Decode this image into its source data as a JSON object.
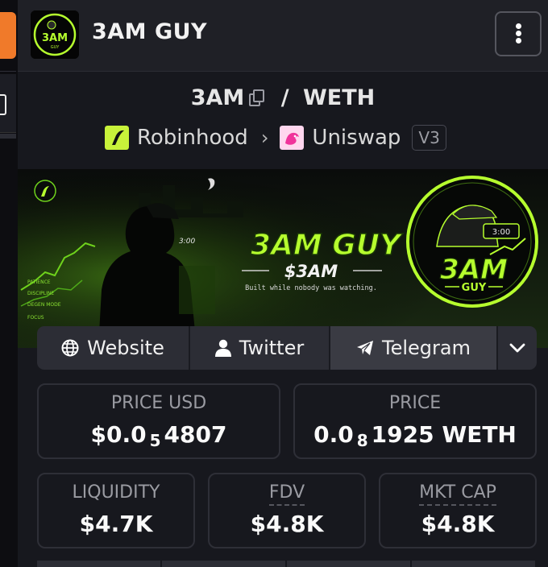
{
  "header": {
    "title": "3AM GUY"
  },
  "pair": {
    "base": "3AM",
    "separator": "/",
    "quote": "WETH"
  },
  "chain": {
    "name": "Robinhood",
    "dex": "Uniswap",
    "version": "V3"
  },
  "banner": {
    "title": "3AM GUY",
    "ticker": "$3AM",
    "tagline": "Built while nobody was watching.",
    "time": "3:00",
    "badge_title": "3AM",
    "badge_sub": "GUY",
    "side_labels": [
      "PATIENCE",
      "DISCIPLINE",
      "DEGEN MODE",
      "FOCUS"
    ]
  },
  "links": {
    "website": "Website",
    "twitter": "Twitter",
    "telegram": "Telegram"
  },
  "stats": {
    "price_usd_label": "PRICE USD",
    "price_usd_prefix": "$0.0",
    "price_usd_zeros": "5",
    "price_usd_digits": "4807",
    "price_label": "PRICE",
    "price_prefix": "0.0",
    "price_zeros": "8",
    "price_digits": "1925 WETH",
    "liquidity_label": "LIQUIDITY",
    "liquidity_value": "$4.7K",
    "fdv_label": "FDV",
    "fdv_value": "$4.8K",
    "mktcap_label": "MKT CAP",
    "mktcap_value": "$4.8K"
  },
  "colors": {
    "accent_green": "#b6ff2e",
    "panel": "#17181e",
    "button": "#2c2d35",
    "orange": "#f07a2a"
  },
  "icons": [
    "kebab-menu-icon",
    "copy-icon",
    "robinhood-icon",
    "chevron-right-icon",
    "uniswap-icon",
    "globe-icon",
    "user-icon",
    "telegram-icon",
    "chevron-down-icon"
  ]
}
